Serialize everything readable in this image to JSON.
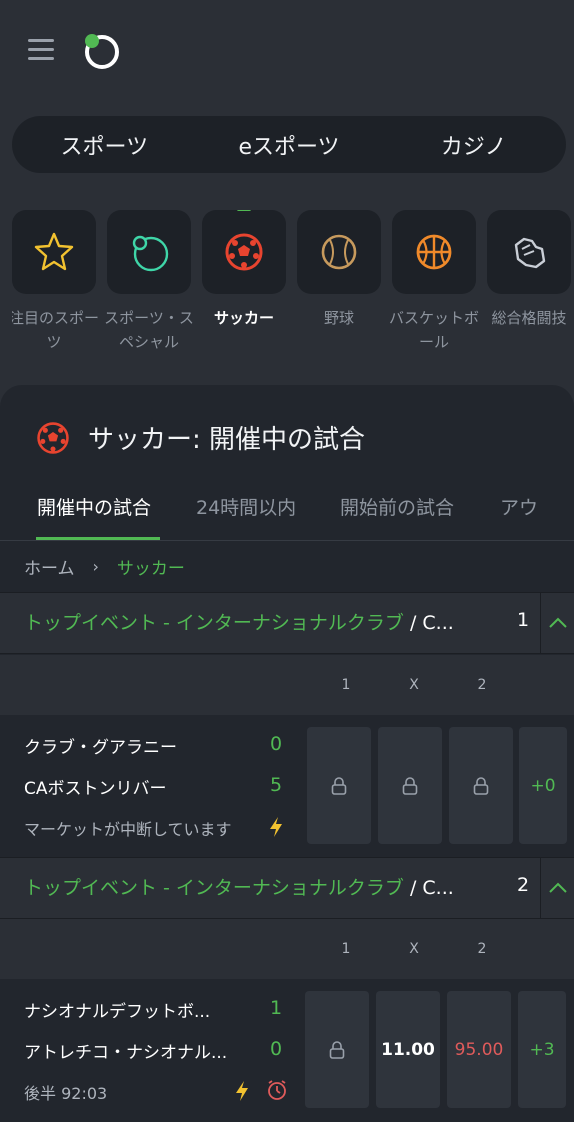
{
  "top_nav": {
    "segments": [
      "スポーツ",
      "eスポーツ",
      "カジノ"
    ]
  },
  "categories": [
    {
      "label": "注目のスポーツ",
      "icon": "star-icon"
    },
    {
      "label": "スポーツ・スペシャル",
      "icon": "specials-icon"
    },
    {
      "label": "サッカー",
      "icon": "soccer-ball-icon",
      "active": true
    },
    {
      "label": "野球",
      "icon": "baseball-icon"
    },
    {
      "label": "バスケットボール",
      "icon": "basketball-icon"
    },
    {
      "label": "総合格闘技",
      "icon": "mma-glove-icon"
    }
  ],
  "panel": {
    "title": "サッカー: 開催中の試合",
    "tabs": [
      "開催中の試合",
      "24時間以内",
      "開始前の試合",
      "アウ"
    ]
  },
  "breadcrumb": {
    "home": "ホーム",
    "separator": "›",
    "current": "サッカー"
  },
  "leagues": [
    {
      "name": "トップイベント - インターナショナルクラブ",
      "name_rest": " / C...",
      "count": "1",
      "columns": [
        "1",
        "X",
        "2"
      ],
      "match": {
        "home": "クラブ・グアラニー",
        "away": "CAボストンリバー",
        "home_score": "0",
        "away_score": "5",
        "status": "マーケットが中断しています",
        "odds": [
          "",
          "",
          ""
        ],
        "more": "+0"
      }
    },
    {
      "name": "トップイベント - インターナショナルクラブ",
      "name_rest": " / C...",
      "count": "2",
      "columns": [
        "1",
        "X",
        "2"
      ],
      "match": {
        "home": "ナシオナルデフットボ...",
        "away": "アトレチコ・ナシオナル...",
        "home_score": "1",
        "away_score": "0",
        "status": "後半 92:03",
        "odds": [
          "",
          "11.00",
          "95.00"
        ],
        "more": "+3"
      }
    }
  ],
  "colors": {
    "accent": "#51b953",
    "background": "#2b2f36",
    "panel": "#22262d",
    "odd_red": "#e05b5b"
  }
}
